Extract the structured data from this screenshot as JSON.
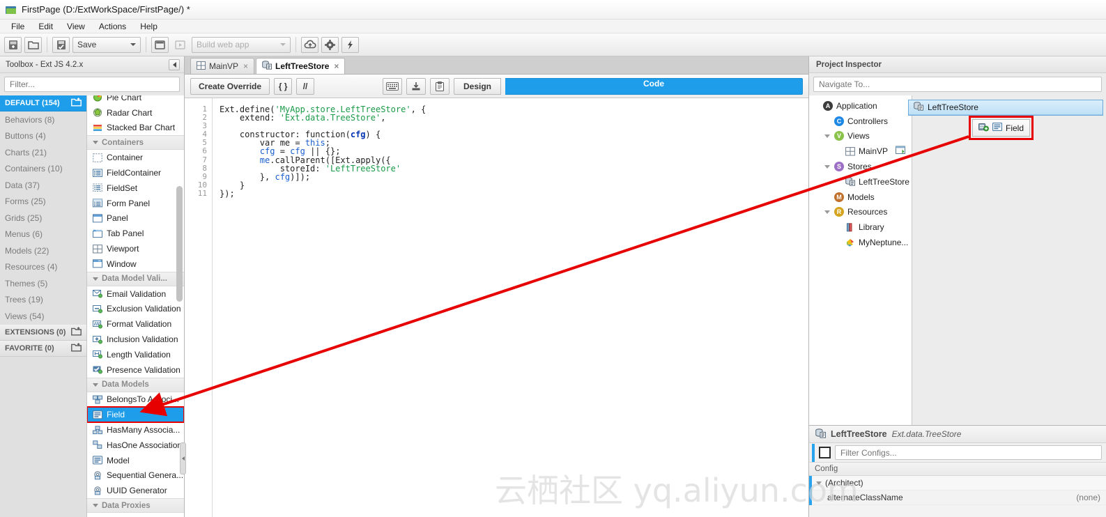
{
  "window": {
    "title": "FirstPage (D:/ExtWorkSpace/FirstPage/) *",
    "icon": "app-folder-icon"
  },
  "menubar": {
    "items": [
      {
        "label": "File"
      },
      {
        "label": "Edit"
      },
      {
        "label": "View"
      },
      {
        "label": "Actions"
      },
      {
        "label": "Help"
      }
    ]
  },
  "toolbar": {
    "new_label": "",
    "open_label": "",
    "save_label": "Save",
    "build_label": "Build web app",
    "icons": [
      "new-project-icon",
      "open-project-icon",
      "save-icon",
      "preview-window-icon",
      "run-icon",
      "deploy-cloud-icon",
      "settings-gear-icon",
      "lightning-icon"
    ]
  },
  "toolbox": {
    "header": "Toolbox - Ext JS 4.2.x",
    "filter_placeholder": "Filter...",
    "categories": [
      {
        "label": "DEFAULT (154)",
        "selected": true,
        "icon": "folder-open-icon"
      },
      {
        "label": "Behaviors (8)",
        "selected": false
      },
      {
        "label": "Buttons (4)",
        "selected": false
      },
      {
        "label": "Charts (21)",
        "selected": false
      },
      {
        "label": "Containers (10)",
        "selected": false
      },
      {
        "label": "Data (37)",
        "selected": false
      },
      {
        "label": "Forms (25)",
        "selected": false
      },
      {
        "label": "Grids (25)",
        "selected": false
      },
      {
        "label": "Menus (6)",
        "selected": false
      },
      {
        "label": "Models (22)",
        "selected": false
      },
      {
        "label": "Resources (4)",
        "selected": false
      },
      {
        "label": "Themes (5)",
        "selected": false
      },
      {
        "label": "Trees (19)",
        "selected": false
      },
      {
        "label": "Views (54)",
        "selected": false
      },
      {
        "label": "EXTENSIONS (0)",
        "selected": false,
        "icon": "folder-open-icon"
      },
      {
        "label": "FAVORITE (0)",
        "selected": false,
        "icon": "folder-add-icon"
      }
    ],
    "components": [
      {
        "type": "item",
        "label": "Pie Chart",
        "icon": "pie-chart-icon",
        "clipped": true
      },
      {
        "type": "item",
        "label": "Radar Chart",
        "icon": "radar-chart-icon"
      },
      {
        "type": "item",
        "label": "Stacked Bar Chart",
        "icon": "stacked-bar-chart-icon"
      },
      {
        "type": "group",
        "label": "Containers"
      },
      {
        "type": "item",
        "label": "Container",
        "icon": "container-icon"
      },
      {
        "type": "item",
        "label": "FieldContainer",
        "icon": "field-container-icon"
      },
      {
        "type": "item",
        "label": "FieldSet",
        "icon": "fieldset-icon"
      },
      {
        "type": "item",
        "label": "Form Panel",
        "icon": "form-panel-icon"
      },
      {
        "type": "item",
        "label": "Panel",
        "icon": "panel-icon"
      },
      {
        "type": "item",
        "label": "Tab Panel",
        "icon": "tab-panel-icon"
      },
      {
        "type": "item",
        "label": "Viewport",
        "icon": "viewport-icon"
      },
      {
        "type": "item",
        "label": "Window",
        "icon": "window-icon"
      },
      {
        "type": "group",
        "label": "Data Model Vali..."
      },
      {
        "type": "item",
        "label": "Email Validation",
        "icon": "email-validation-icon"
      },
      {
        "type": "item",
        "label": "Exclusion Validation",
        "icon": "exclusion-validation-icon"
      },
      {
        "type": "item",
        "label": "Format Validation",
        "icon": "format-validation-icon"
      },
      {
        "type": "item",
        "label": "Inclusion Validation",
        "icon": "inclusion-validation-icon"
      },
      {
        "type": "item",
        "label": "Length Validation",
        "icon": "length-validation-icon"
      },
      {
        "type": "item",
        "label": "Presence Validation",
        "icon": "presence-validation-icon"
      },
      {
        "type": "group",
        "label": "Data Models"
      },
      {
        "type": "item",
        "label": "BelongsTo Associ...",
        "icon": "belongsto-association-icon"
      },
      {
        "type": "item",
        "label": "Field",
        "icon": "field-icon",
        "selected": true,
        "highlighted": true
      },
      {
        "type": "item",
        "label": "HasMany Associa...",
        "icon": "hasmany-association-icon"
      },
      {
        "type": "item",
        "label": "HasOne Association",
        "icon": "hasone-association-icon"
      },
      {
        "type": "item",
        "label": "Model",
        "icon": "model-icon"
      },
      {
        "type": "item",
        "label": "Sequential Genera...",
        "icon": "sequential-generator-icon"
      },
      {
        "type": "item",
        "label": "UUID Generator",
        "icon": "uuid-generator-icon"
      },
      {
        "type": "group",
        "label": "Data Proxies"
      }
    ]
  },
  "editor": {
    "tabs": [
      {
        "label": "MainVP",
        "icon": "viewport-icon",
        "active": false,
        "close": "×"
      },
      {
        "label": "LeftTreeStore",
        "icon": "store-icon",
        "active": true,
        "close": "×"
      }
    ],
    "toolbar": {
      "create_override": "Create Override",
      "braces": "{ }",
      "comment": "//",
      "keyboard_icon": "keyboard-icon",
      "export_icon": "export-icon",
      "clipboard_icon": "clipboard-icon",
      "design_label": "Design",
      "code_label": "Code",
      "active_view": "Code",
      "list_icon": "list-view-icon"
    },
    "line_numbers": [
      "1",
      "2",
      "3",
      "4",
      "5",
      "6",
      "7",
      "8",
      "9",
      "10",
      "11"
    ],
    "code_lines": [
      [
        {
          "t": "Ext.define(",
          "c": "plain"
        },
        {
          "t": "'MyApp.store.LeftTreeStore'",
          "c": "str"
        },
        {
          "t": ", {",
          "c": "plain"
        }
      ],
      [
        {
          "t": "    extend: ",
          "c": "plain"
        },
        {
          "t": "'Ext.data.TreeStore'",
          "c": "str"
        },
        {
          "t": ",",
          "c": "plain"
        }
      ],
      [
        {
          "t": "",
          "c": "plain"
        }
      ],
      [
        {
          "t": "    constructor: function(",
          "c": "plain"
        },
        {
          "t": "cfg",
          "c": "kw"
        },
        {
          "t": ") {",
          "c": "plain"
        }
      ],
      [
        {
          "t": "        var me = ",
          "c": "plain"
        },
        {
          "t": "this",
          "c": "blue"
        },
        {
          "t": ";",
          "c": "plain"
        }
      ],
      [
        {
          "t": "        ",
          "c": "plain"
        },
        {
          "t": "cfg",
          "c": "blue"
        },
        {
          "t": " = ",
          "c": "plain"
        },
        {
          "t": "cfg",
          "c": "blue"
        },
        {
          "t": " || {};",
          "c": "plain"
        }
      ],
      [
        {
          "t": "        ",
          "c": "plain"
        },
        {
          "t": "me",
          "c": "blue"
        },
        {
          "t": ".callParent([Ext.apply({",
          "c": "plain"
        }
      ],
      [
        {
          "t": "            storeId: ",
          "c": "plain"
        },
        {
          "t": "'LeftTreeStore'",
          "c": "str"
        }
      ],
      [
        {
          "t": "        }, ",
          "c": "plain"
        },
        {
          "t": "cfg",
          "c": "blue"
        },
        {
          "t": ")]);",
          "c": "plain"
        }
      ],
      [
        {
          "t": "    }",
          "c": "plain"
        }
      ],
      [
        {
          "t": "});",
          "c": "plain"
        }
      ]
    ]
  },
  "inspector": {
    "header": "Project Inspector",
    "navigate_placeholder": "Navigate To...",
    "tree": [
      {
        "label": "Application",
        "indent": 0,
        "twisty": false,
        "badge": "A",
        "color": "#3c3c3c"
      },
      {
        "label": "Controllers",
        "indent": 1,
        "twisty": false,
        "badge": "C",
        "color": "#1e88e5"
      },
      {
        "label": "Views",
        "indent": 1,
        "twisty": true,
        "badge": "V",
        "color": "#8bc34a"
      },
      {
        "label": "MainVP",
        "indent": 2,
        "twisty": false,
        "icon": "viewport-icon",
        "trailing": "design-icon"
      },
      {
        "label": "Stores",
        "indent": 1,
        "twisty": true,
        "badge": "S",
        "color": "#9c6fc4"
      },
      {
        "label": "LeftTreeStore",
        "indent": 2,
        "twisty": false,
        "icon": "store-icon",
        "trailing": "error-icon"
      },
      {
        "label": "Models",
        "indent": 1,
        "twisty": false,
        "badge": "M",
        "color": "#c0702a"
      },
      {
        "label": "Resources",
        "indent": 1,
        "twisty": true,
        "badge": "R",
        "color": "#d5a520"
      },
      {
        "label": "Library",
        "indent": 2,
        "twisty": false,
        "icon": "library-icon"
      },
      {
        "label": "MyNeptune...",
        "indent": 2,
        "twisty": false,
        "icon": "theme-icon",
        "trailing": "ok-icon"
      }
    ],
    "canvas_node": {
      "title": "LeftTreeStore",
      "icon": "store-icon",
      "child_label": "Field",
      "child_icons": [
        "add-field-icon",
        "field-icon"
      ],
      "highlighted": true
    }
  },
  "config_panel": {
    "title": "LeftTreeStore",
    "subtitle": "Ext.data.TreeStore",
    "icon": "store-icon",
    "filter_placeholder": "Filter Configs...",
    "column_header": "Config",
    "rows": [
      {
        "label": "(Architect)",
        "value": "",
        "group": true
      },
      {
        "label": "alternateClassName",
        "value": "(none)",
        "group": false
      }
    ]
  },
  "watermark": {
    "text": "云栖社区 yq.aliyun.com"
  },
  "colors": {
    "accent_blue": "#1e9eea",
    "highlight_red": "#e60000",
    "arrow_red": "#e60000",
    "selection_blue": "#1e9eea"
  }
}
